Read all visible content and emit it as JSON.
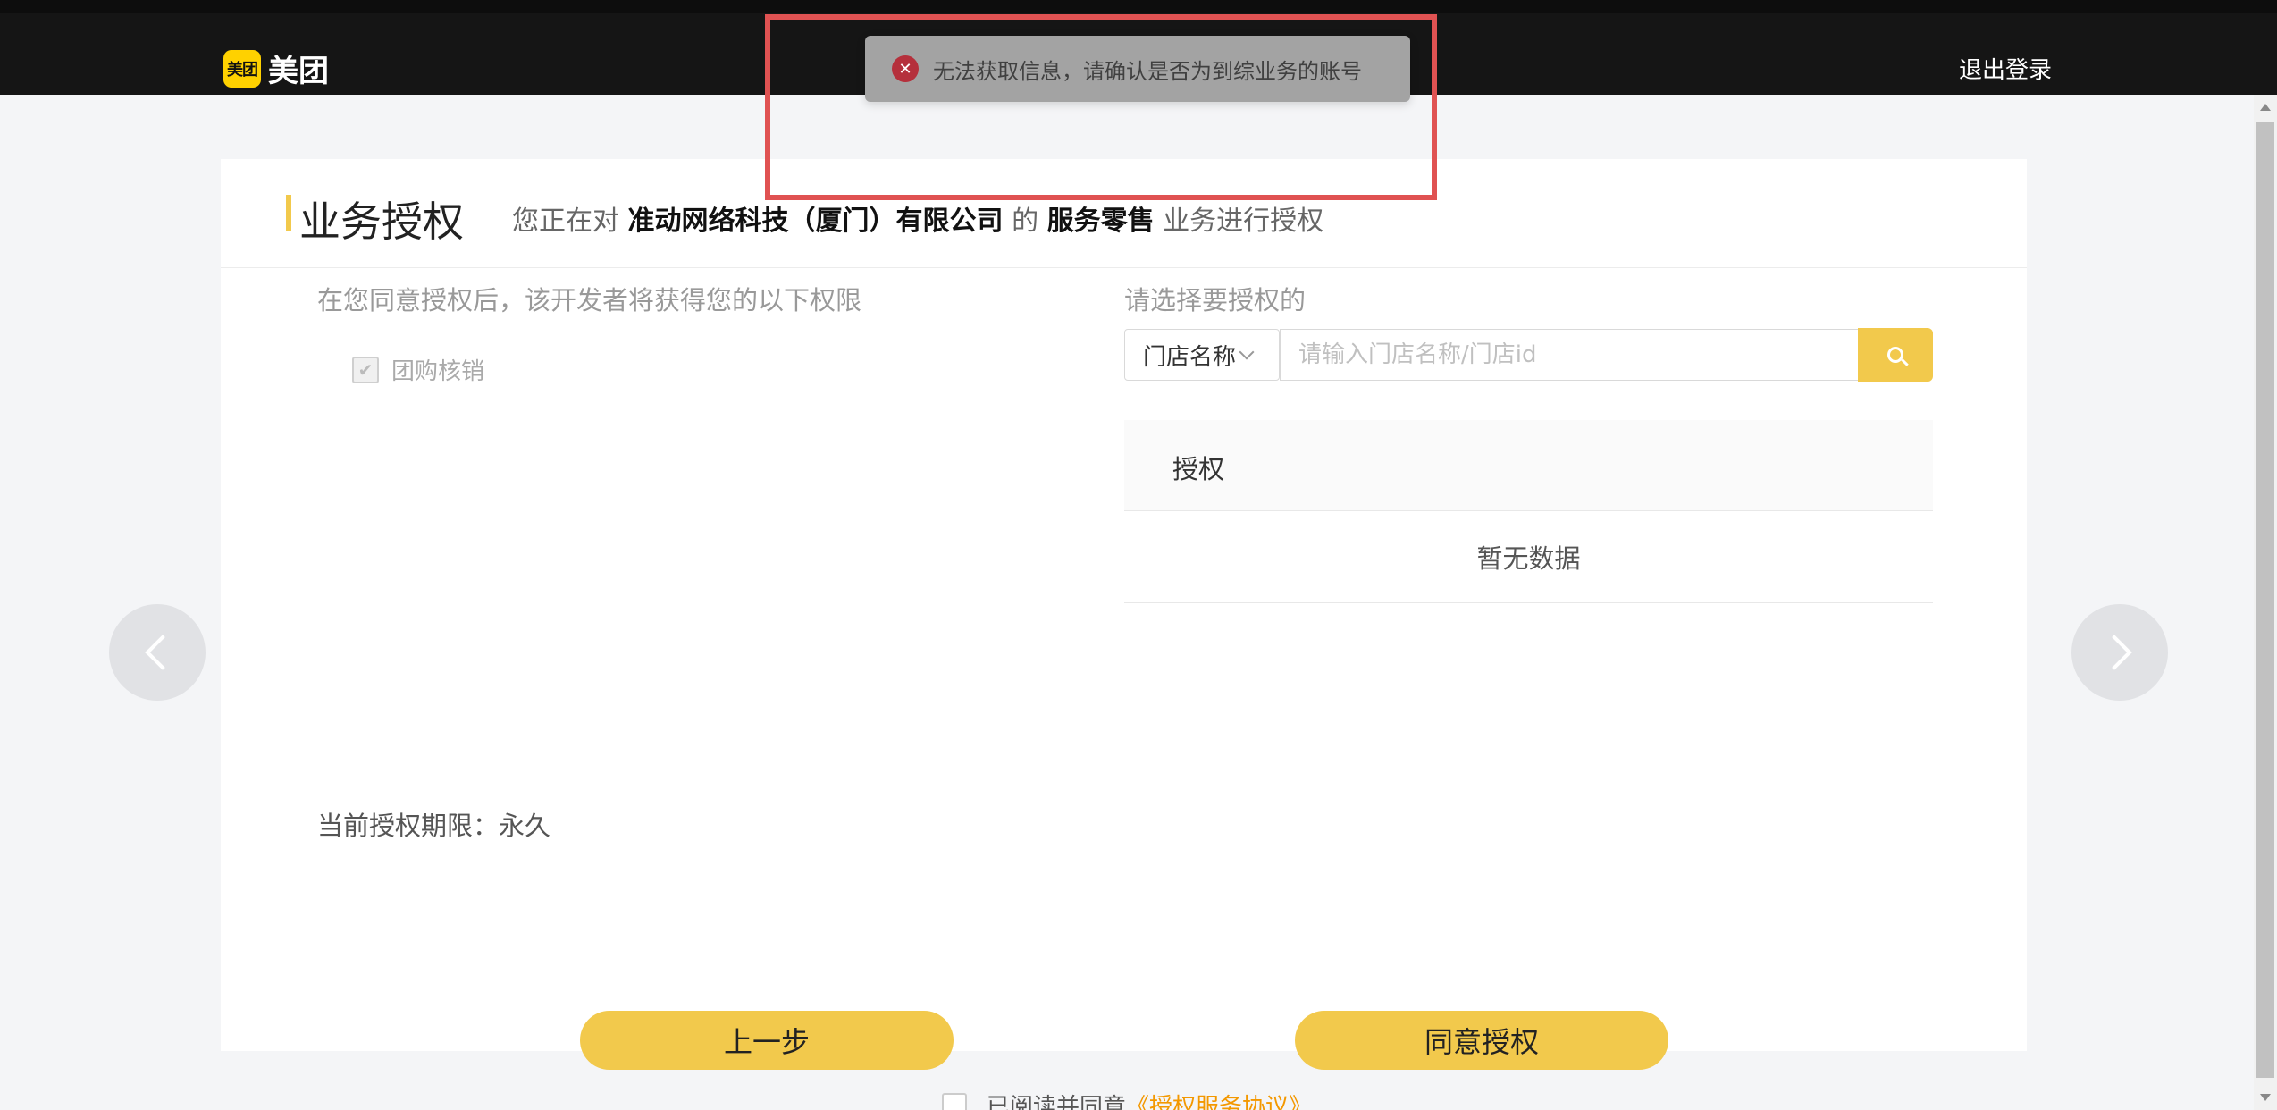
{
  "header": {
    "logo_badge": "美团",
    "logo_text": "美团",
    "logout_label": "退出登录"
  },
  "toast": {
    "icon": "error-icon",
    "message": "无法获取信息，请确认是否为到综业务的账号"
  },
  "page": {
    "title": "业务授权",
    "subtitle_prefix": "您正在对",
    "company": "准动网络科技（厦门）有限公司",
    "subtitle_mid": "的",
    "business": "服务零售",
    "subtitle_suffix": "业务进行授权"
  },
  "permissions": {
    "label": "在您同意授权后，该开发者将获得您的以下权限",
    "items": [
      {
        "label": "团购核销",
        "checked": true
      }
    ],
    "period": "当前授权期限：永久"
  },
  "store_select": {
    "label": "请选择要授权的",
    "dropdown_value": "门店名称",
    "search_placeholder": "请输入门店名称/门店id",
    "table_header": "授权",
    "empty_text": "暂无数据"
  },
  "actions": {
    "prev_label": "上一步",
    "agree_label": "同意授权"
  },
  "agreement": {
    "prefix": "已阅读并同意",
    "link": "《授权服务协议》"
  },
  "colors": {
    "accent": "#f2c94c",
    "header_bg": "#151515",
    "link": "#f39800",
    "error": "#b5303c",
    "highlight": "#e05252"
  }
}
